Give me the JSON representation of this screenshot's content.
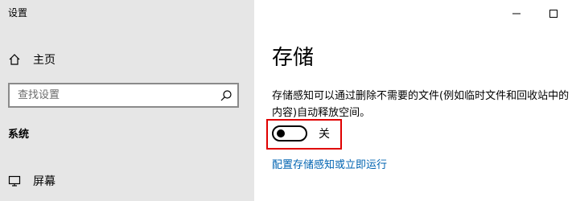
{
  "window": {
    "title": "设置",
    "minimize_icon": "minimize-icon",
    "maximize_icon": "maximize-icon"
  },
  "sidebar": {
    "home_label": "主页",
    "home_icon": "home-icon",
    "search_placeholder": "查找设置",
    "search_icon": "search-icon",
    "section_label": "系统",
    "display_label": "屏幕",
    "display_icon": "monitor-icon"
  },
  "main": {
    "title": "存储",
    "description": "存储感知可以通过删除不需要的文件(例如临时文件和回收站中的内容)自动释放空间。",
    "toggle_state_label": "关",
    "toggle_on": false,
    "config_link": "配置存储感知或立即运行"
  },
  "colors": {
    "sidebar_bg": "#e6e6e6",
    "link": "#0063b1",
    "highlight": "#e00000"
  }
}
